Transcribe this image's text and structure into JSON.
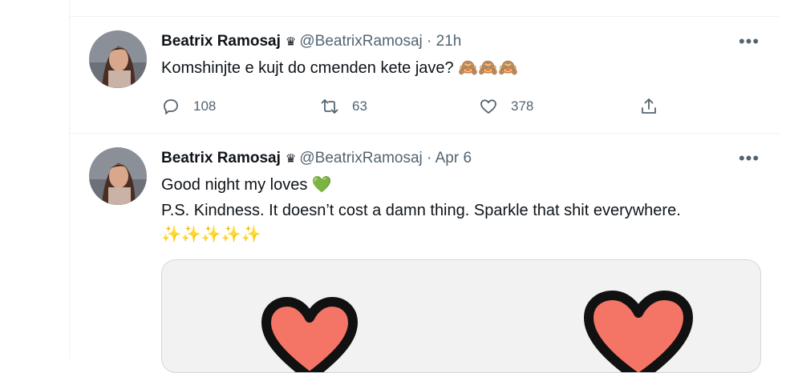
{
  "tweets": [
    {
      "name": "Beatrix Ramosaj",
      "badge": "♛",
      "handle": "@BeatrixRamosaj",
      "dot": "·",
      "time": "21h",
      "more": "•••",
      "lines": [
        "Komshinjte e kujt do cmenden kete jave? 🙈🙈🙈"
      ],
      "replies": "108",
      "retweets": "63",
      "likes": "378"
    },
    {
      "name": "Beatrix Ramosaj",
      "badge": "♛",
      "handle": "@BeatrixRamosaj",
      "dot": "·",
      "time": "Apr 6",
      "more": "•••",
      "lines": [
        "Good night my loves 💚",
        "P.S. Kindness. It doesn’t cost a damn thing. Sparkle that shit everywhere.",
        "✨✨✨✨✨"
      ]
    }
  ],
  "colors": {
    "text": "#0f1419",
    "secondary": "#536471",
    "divider": "#eff3f4",
    "heart_fill": "#f47466",
    "media_bg": "#f2f2f2"
  },
  "icons": [
    "reply-icon",
    "retweet-icon",
    "like-icon",
    "share-icon",
    "more-icon",
    "crown-icon"
  ]
}
